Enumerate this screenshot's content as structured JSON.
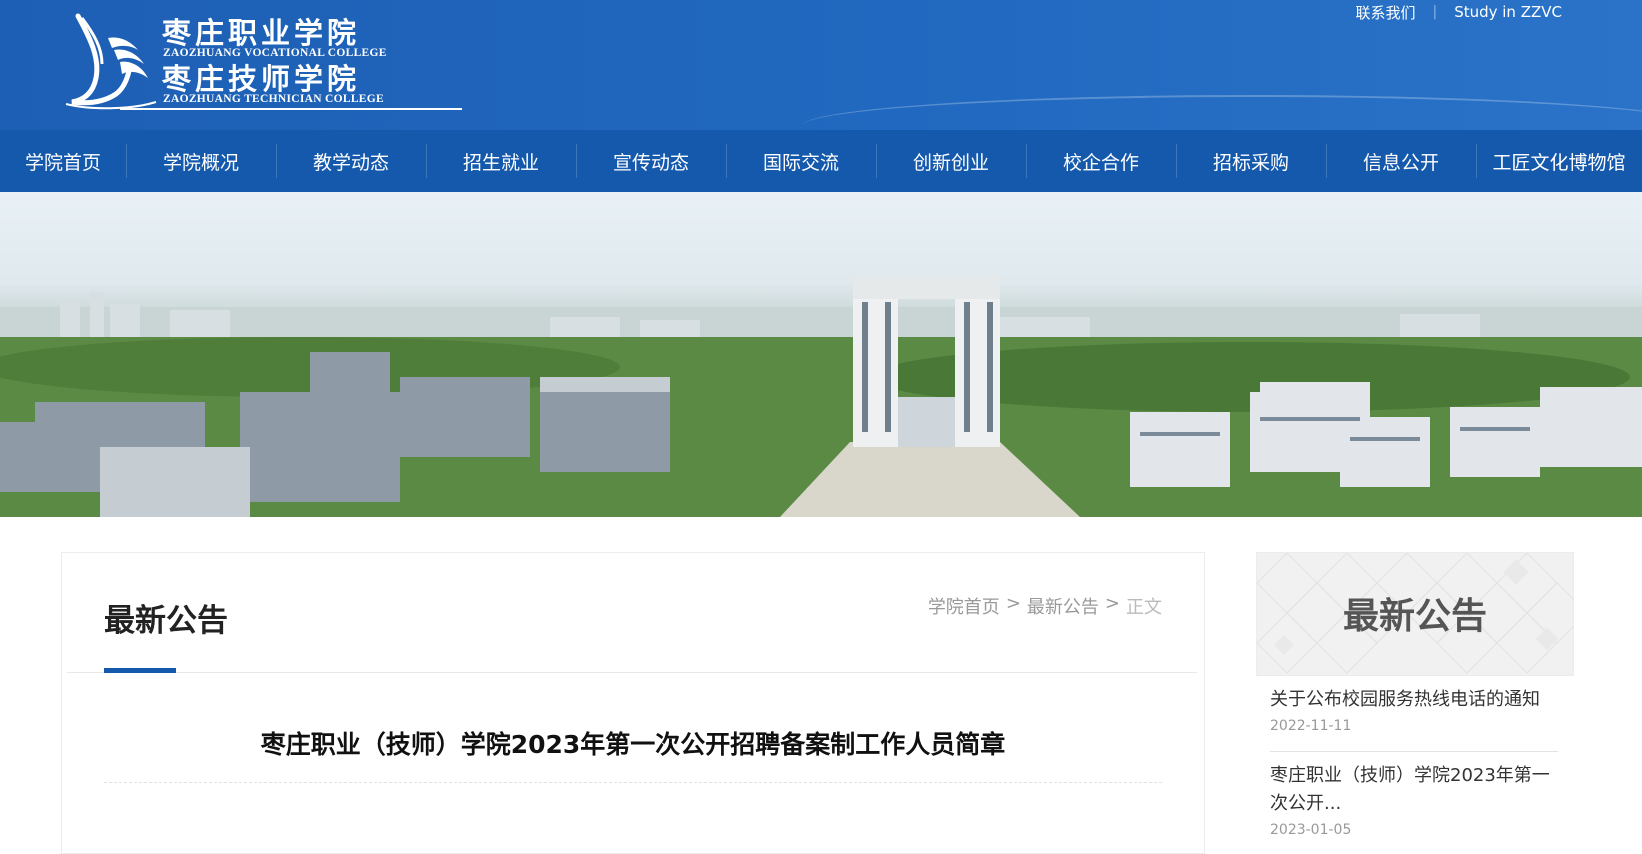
{
  "site": {
    "name_cn_1": "枣庄职业学院",
    "name_en_1": "ZAOZHUANG VOCATIONAL COLLEGE",
    "name_cn_2": "枣庄技师学院",
    "name_en_2": "ZAOZHUANG TECHNICIAN COLLEGE"
  },
  "top_links": {
    "contact": "联系我们",
    "study": "Study in ZZVC"
  },
  "nav": [
    "学院首页",
    "学院概况",
    "教学动态",
    "招生就业",
    "宣传动态",
    "国际交流",
    "创新创业",
    "校企合作",
    "招标采购",
    "信息公开",
    "工匠文化博物馆"
  ],
  "main": {
    "section_title": "最新公告",
    "breadcrumb": {
      "home": "学院首页",
      "section": "最新公告",
      "current": "正文",
      "sep": ">"
    },
    "article_title": "枣庄职业（技师）学院2023年第一次公开招聘备案制工作人员简章"
  },
  "sidebar": {
    "title": "最新公告",
    "items": [
      {
        "title": "关于公布校园服务热线电话的通知",
        "date": "2022-11-11"
      },
      {
        "title": "枣庄职业（技师）学院2023年第一次公开...",
        "date": "2023-01-05"
      }
    ]
  },
  "colors": {
    "header_blue": "#1d5fb4",
    "nav_blue": "#1559ad",
    "accent": "#1559ad"
  }
}
